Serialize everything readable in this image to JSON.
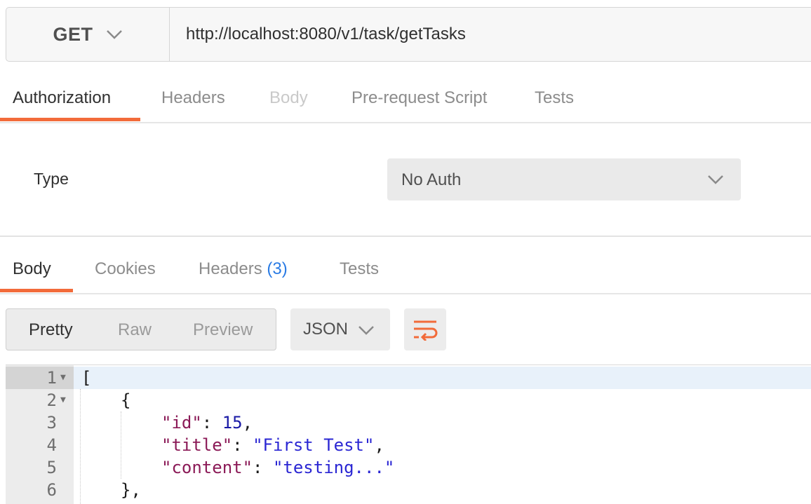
{
  "request": {
    "method": "GET",
    "url": "http://localhost:8080/v1/task/getTasks"
  },
  "request_tabs": [
    "Authorization",
    "Headers",
    "Body",
    "Pre-request Script",
    "Tests"
  ],
  "auth": {
    "type_label": "Type",
    "selected": "No Auth"
  },
  "response_tabs": {
    "body": "Body",
    "cookies": "Cookies",
    "headers": "Headers",
    "headers_count": "(3)",
    "tests": "Tests"
  },
  "view_modes": [
    "Pretty",
    "Raw",
    "Preview"
  ],
  "format": "JSON",
  "icons": {
    "method_dropdown": "chevron-down-icon",
    "auth_dropdown": "chevron-down-icon",
    "format_dropdown": "chevron-down-icon",
    "wrap": "wrap-lines-icon"
  },
  "colors": {
    "accent": "#f26b3a",
    "count": "#2a7be4"
  },
  "code": {
    "line_numbers": [
      "1",
      "2",
      "3",
      "4",
      "5",
      "6"
    ],
    "l1": "[",
    "l2": "{",
    "l3_key": "\"id\"",
    "l3_sep": ": ",
    "l3_val": "15",
    "l3_end": ",",
    "l4_key": "\"title\"",
    "l4_sep": ": ",
    "l4_val": "\"First Test\"",
    "l4_end": ",",
    "l5_key": "\"content\"",
    "l5_sep": ": ",
    "l5_val": "\"testing...\"",
    "l6": "},"
  }
}
